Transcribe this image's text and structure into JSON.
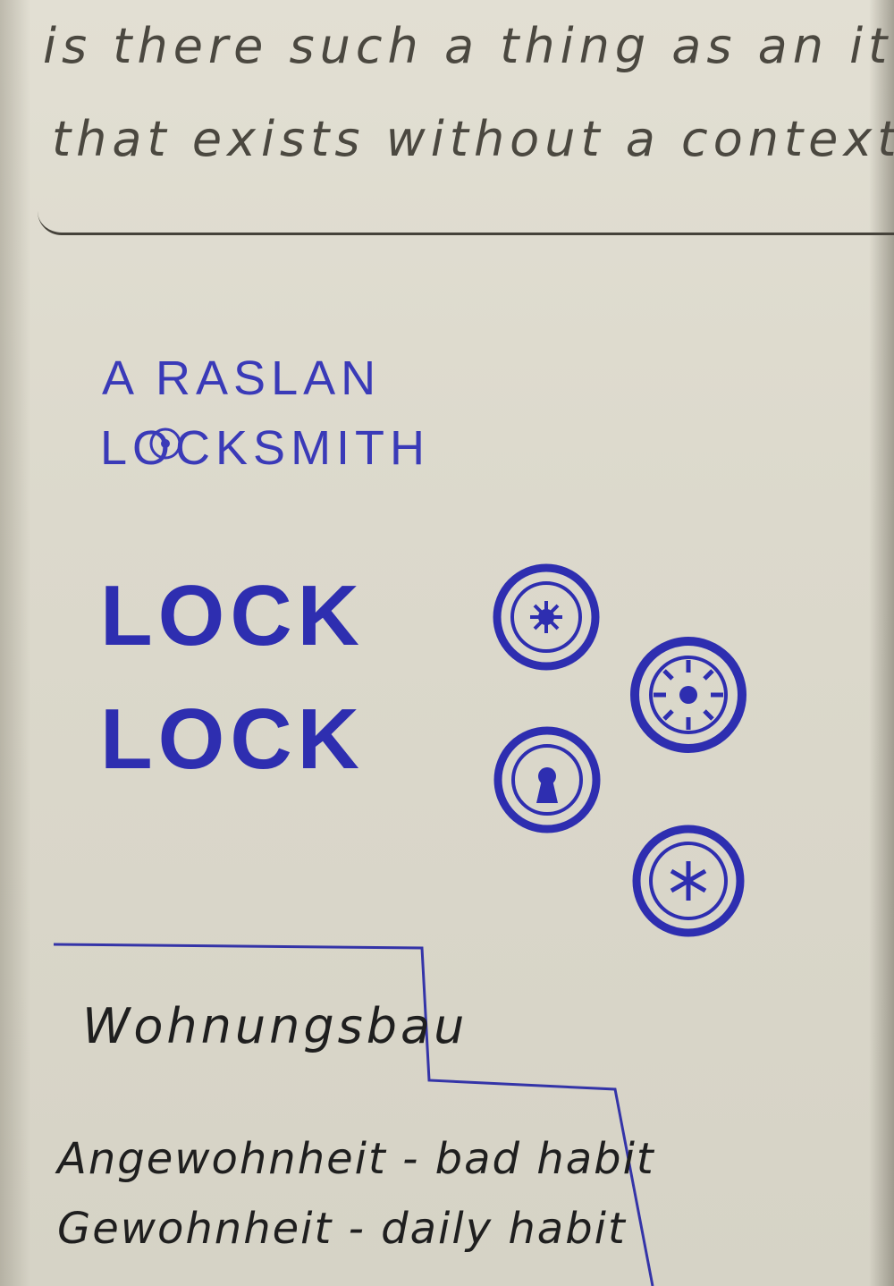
{
  "notebook": {
    "pencil_note": {
      "line_1": "is there such a thing as an ite",
      "line_2": "that exists without a context"
    },
    "sketch": {
      "title_line_1": "A RASLAN",
      "title_line_2": "LOCKSMITH",
      "logo_word_1": "LOCK",
      "logo_word_2": "LOCK"
    },
    "boxed_note": {
      "heading": "Wohnungsbau",
      "vocab_1": "Angewohnheit - bad habit",
      "vocab_2": "Gewohnheit - daily habit"
    },
    "colors": {
      "paper": "#e0ddd1",
      "pencil": "#45423a",
      "blue_ink": "#3a3ab8",
      "black_ink": "#1f1f1f"
    },
    "icons": [
      "lock-dial-icon",
      "lock-star-icon",
      "keyhole-icon",
      "asterisk-lock-icon"
    ]
  }
}
